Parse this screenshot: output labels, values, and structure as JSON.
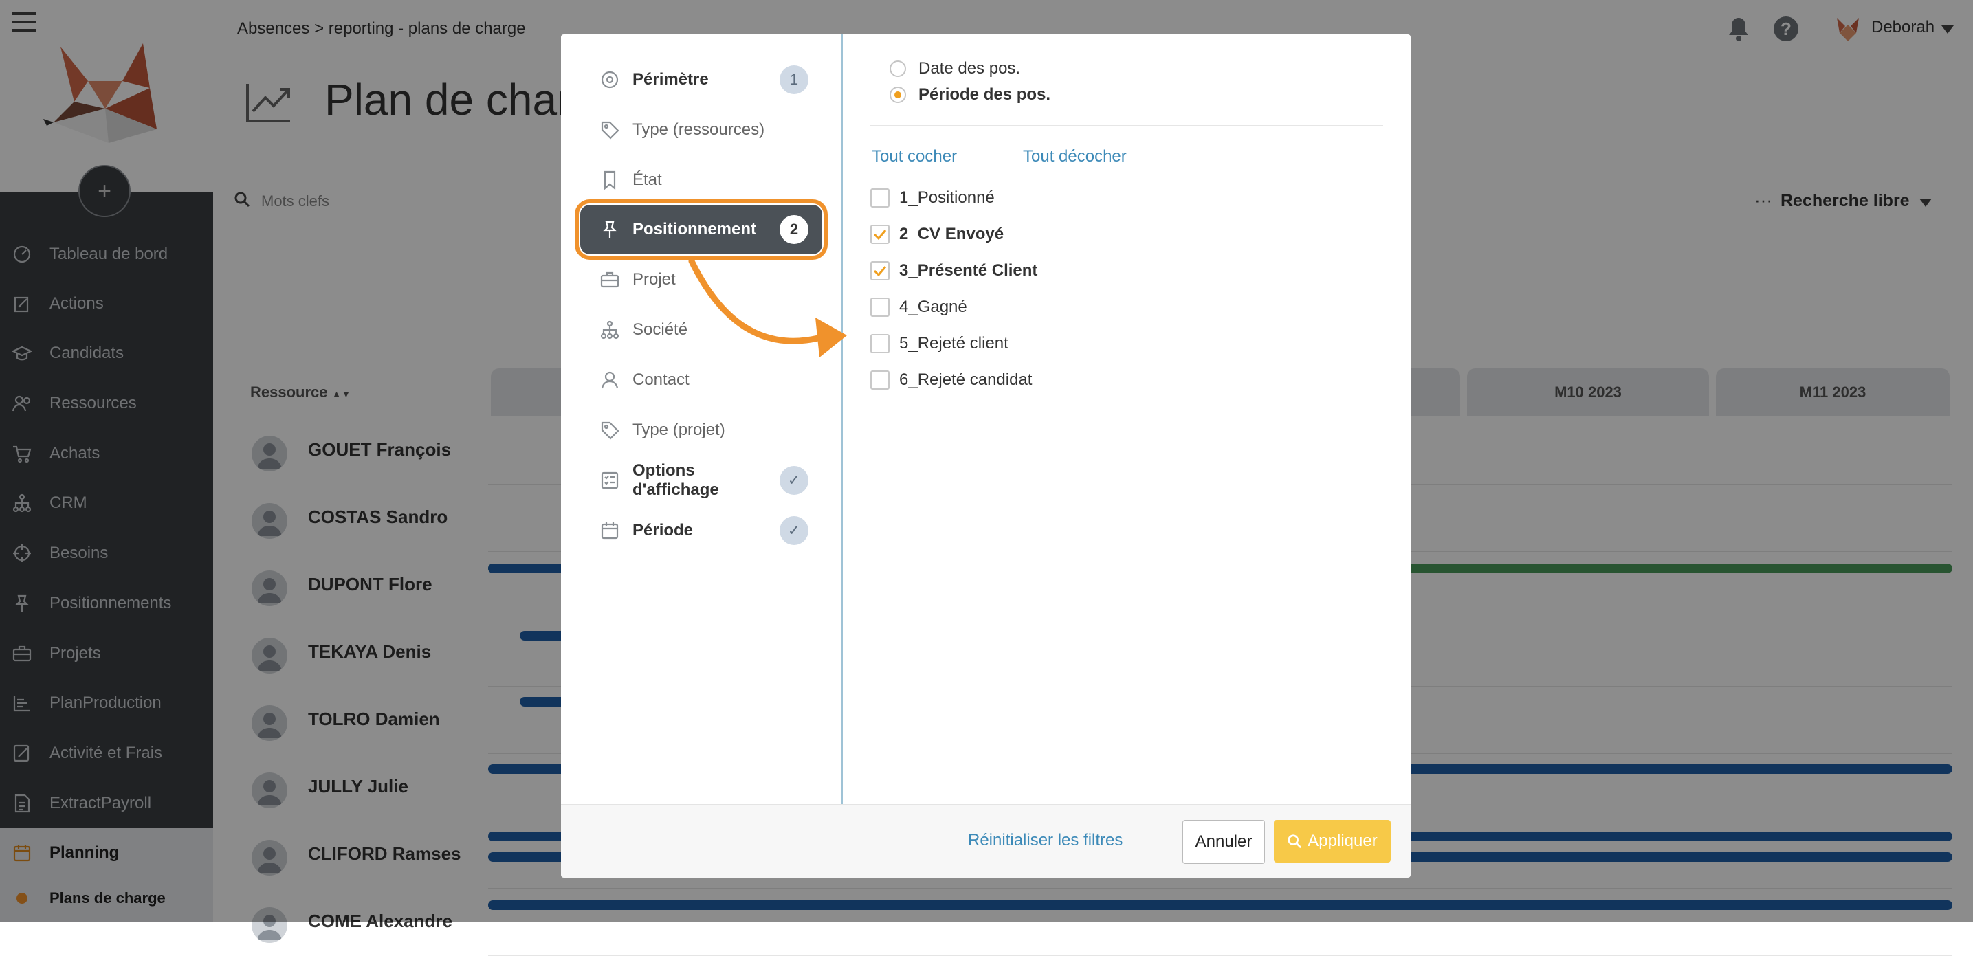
{
  "sidebar": {
    "items": [
      {
        "label": "Tableau de bord",
        "icon": "dashboard-gauge-icon"
      },
      {
        "label": "Actions",
        "icon": "actions-edit-icon"
      },
      {
        "label": "Candidats",
        "icon": "graduation-cap-icon"
      },
      {
        "label": "Ressources",
        "icon": "users-icon"
      },
      {
        "label": "Achats",
        "icon": "cart-icon"
      },
      {
        "label": "CRM",
        "icon": "org-chart-icon"
      },
      {
        "label": "Besoins",
        "icon": "crosshair-icon"
      },
      {
        "label": "Positionnements",
        "icon": "pin-icon"
      },
      {
        "label": "Projets",
        "icon": "briefcase-icon"
      },
      {
        "label": "PlanProduction",
        "icon": "bars-icon"
      },
      {
        "label": "Activité et Frais",
        "icon": "edit-icon"
      },
      {
        "label": "ExtractPayroll",
        "icon": "document-icon"
      },
      {
        "label": "Planning",
        "icon": "calendar-icon"
      }
    ],
    "sub_item": "Plans de charge",
    "add_symbol": "+"
  },
  "header": {
    "breadcrumb": "Absences > reporting - plans de charge",
    "user": "Deborah"
  },
  "page": {
    "title": "Plan de charg",
    "search_placeholder": "Mots clefs",
    "free_search": "Recherche libre",
    "resource_col": "Ressource",
    "months": [
      "M10 2023",
      "M11 2023"
    ],
    "rows": [
      "GOUET François",
      "COSTAS Sandro",
      "DUPONT Flore",
      "TEKAYA Denis",
      "TOLRO Damien",
      "JULLY Julie",
      "CLIFORD Ramses",
      "COME Alexandre"
    ]
  },
  "modal": {
    "filters": [
      {
        "label": "Périmètre",
        "badge": "1",
        "icon": "target-icon"
      },
      {
        "label": "Type (ressources)",
        "icon": "tag-icon"
      },
      {
        "label": "État",
        "icon": "bookmark-icon"
      },
      {
        "label": "Positionnement",
        "badge": "2",
        "icon": "pin-icon"
      },
      {
        "label": "Projet",
        "icon": "briefcase-icon"
      },
      {
        "label": "Société",
        "icon": "org-chart-icon"
      },
      {
        "label": "Contact",
        "icon": "user-icon"
      },
      {
        "label": "Type (projet)",
        "icon": "tag-icon"
      },
      {
        "label": "Options d'affichage",
        "badge": "✓",
        "icon": "list-check-icon"
      },
      {
        "label": "Période",
        "badge": "✓",
        "icon": "calendar-icon"
      }
    ],
    "radios": [
      {
        "label": "Date des pos.",
        "checked": false
      },
      {
        "label": "Période des pos.",
        "checked": true
      }
    ],
    "check_all": "Tout cocher",
    "uncheck_all": "Tout décocher",
    "options": [
      {
        "label": "1_Positionné",
        "checked": false
      },
      {
        "label": "2_CV Envoyé",
        "checked": true
      },
      {
        "label": "3_Présenté Client",
        "checked": true
      },
      {
        "label": "4_Gagné",
        "checked": false
      },
      {
        "label": "5_Rejeté client",
        "checked": false
      },
      {
        "label": "6_Rejeté candidat",
        "checked": false
      }
    ],
    "reset": "Réinitialiser les filtres",
    "cancel": "Annuler",
    "apply": "Appliquer"
  },
  "colors": {
    "accent_orange": "#f0922c",
    "apply_yellow": "#f7c948",
    "link_blue": "#3d8ab8",
    "bar_blue": "#1f5fa8",
    "bar_green": "#4a9a5a",
    "sidebar_dark": "#3b3f43"
  }
}
